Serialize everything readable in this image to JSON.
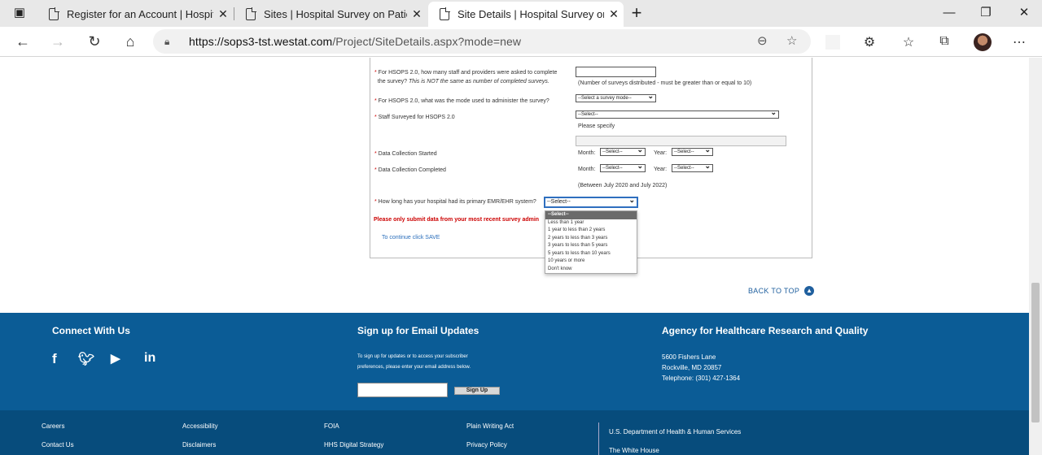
{
  "browser": {
    "tabs": [
      {
        "title": "Register for an Account | Hospita",
        "close": "✕"
      },
      {
        "title": "Sites | Hospital Survey on Patient",
        "close": "✕"
      },
      {
        "title": "Site Details | Hospital Survey on P",
        "close": "✕"
      }
    ],
    "new_tab": "+",
    "url_host": "https://sops3-tst.westat.com",
    "url_path": "/Project/SiteDetails.aspx?mode=new"
  },
  "form": {
    "q_staff_asked_1": "For HSOPS 2.0, how many staff and providers were asked to complete",
    "q_staff_asked_2": "the survey?",
    "q_staff_asked_note": "This is NOT the same as number of completed surveys.",
    "hint_distributed": "(Number of surveys distributed - must be greater than or equal to 10)",
    "q_mode": "For HSOPS 2.0, what was the mode used to administer the survey?",
    "mode_select": "--Select a survey mode--",
    "q_staff_surveyed": "Staff Surveyed for HSOPS 2.0",
    "staff_select": "--Select--",
    "please_specify": "Please specify",
    "q_started": "Data Collection Started",
    "q_completed": "Data Collection Completed",
    "month_label": "Month:",
    "year_label": "Year:",
    "select_short": "--Select--",
    "date_hint": "(Between July 2020 and July 2022)",
    "q_emr": "How long has your hospital had its primary EMR/EHR system?",
    "emr_select": "--Select--",
    "emr_options": [
      "--Select--",
      "Less than 1 year",
      "1 year to less than 2 years",
      "2 years to less than 3 years",
      "3 years to less than 5 years",
      "5 years to less than 10 years",
      "10 years or more",
      "Don't know"
    ],
    "warning": "Please only submit data from your most recent survey admin",
    "continue": "To continue click SAVE",
    "back_to_top": "BACK TO TOP"
  },
  "footer": {
    "connect": "Connect With Us",
    "signup_heading": "Sign up for Email Updates",
    "signup_text_1": "To sign up for updates or to access your subscriber",
    "signup_text_2": "preferences, please enter your email address below.",
    "signup_button": "Sign Up",
    "agency": "Agency for Healthcare Research and Quality",
    "address_1": "5600 Fishers Lane",
    "address_2": "Rockville, MD 20857",
    "phone": "Telephone: (301) 427-1364",
    "links": {
      "careers": "Careers",
      "contact": "Contact Us",
      "accessibility": "Accessibility",
      "disclaimers": "Disclaimers",
      "foia": "FOIA",
      "hhs_digital": "HHS Digital Strategy",
      "plain_writing": "Plain Writing Act",
      "privacy": "Privacy Policy",
      "hhs": "U.S. Department of Health & Human Services",
      "white_house": "The White House"
    }
  }
}
